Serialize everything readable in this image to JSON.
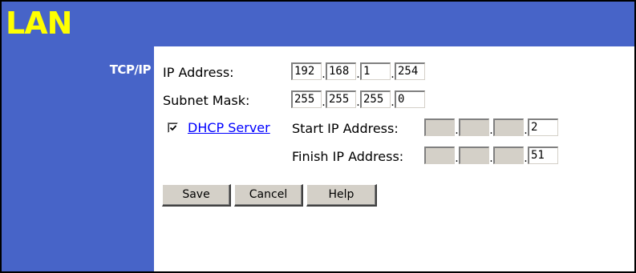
{
  "header": {
    "title": "LAN"
  },
  "sidebar": {
    "section_label": "TCP/IP"
  },
  "form": {
    "ip_address": {
      "label": "IP Address:",
      "octets": [
        "192",
        "168",
        "1",
        "254"
      ]
    },
    "subnet_mask": {
      "label": "Subnet Mask:",
      "octets": [
        "255",
        "255",
        "255",
        "0"
      ]
    },
    "dhcp": {
      "checked": true,
      "link_label": "DHCP Server",
      "start": {
        "label": "Start IP Address:",
        "octets": [
          "",
          "",
          "",
          "2"
        ]
      },
      "finish": {
        "label": "Finish IP Address:",
        "octets": [
          "",
          "",
          "",
          "51"
        ]
      }
    }
  },
  "buttons": {
    "save": "Save",
    "cancel": "Cancel",
    "help": "Help"
  },
  "colors": {
    "header_bg": "#4764c8",
    "title": "#ffff00",
    "link": "#0000ff",
    "button_face": "#d4d0c8"
  }
}
